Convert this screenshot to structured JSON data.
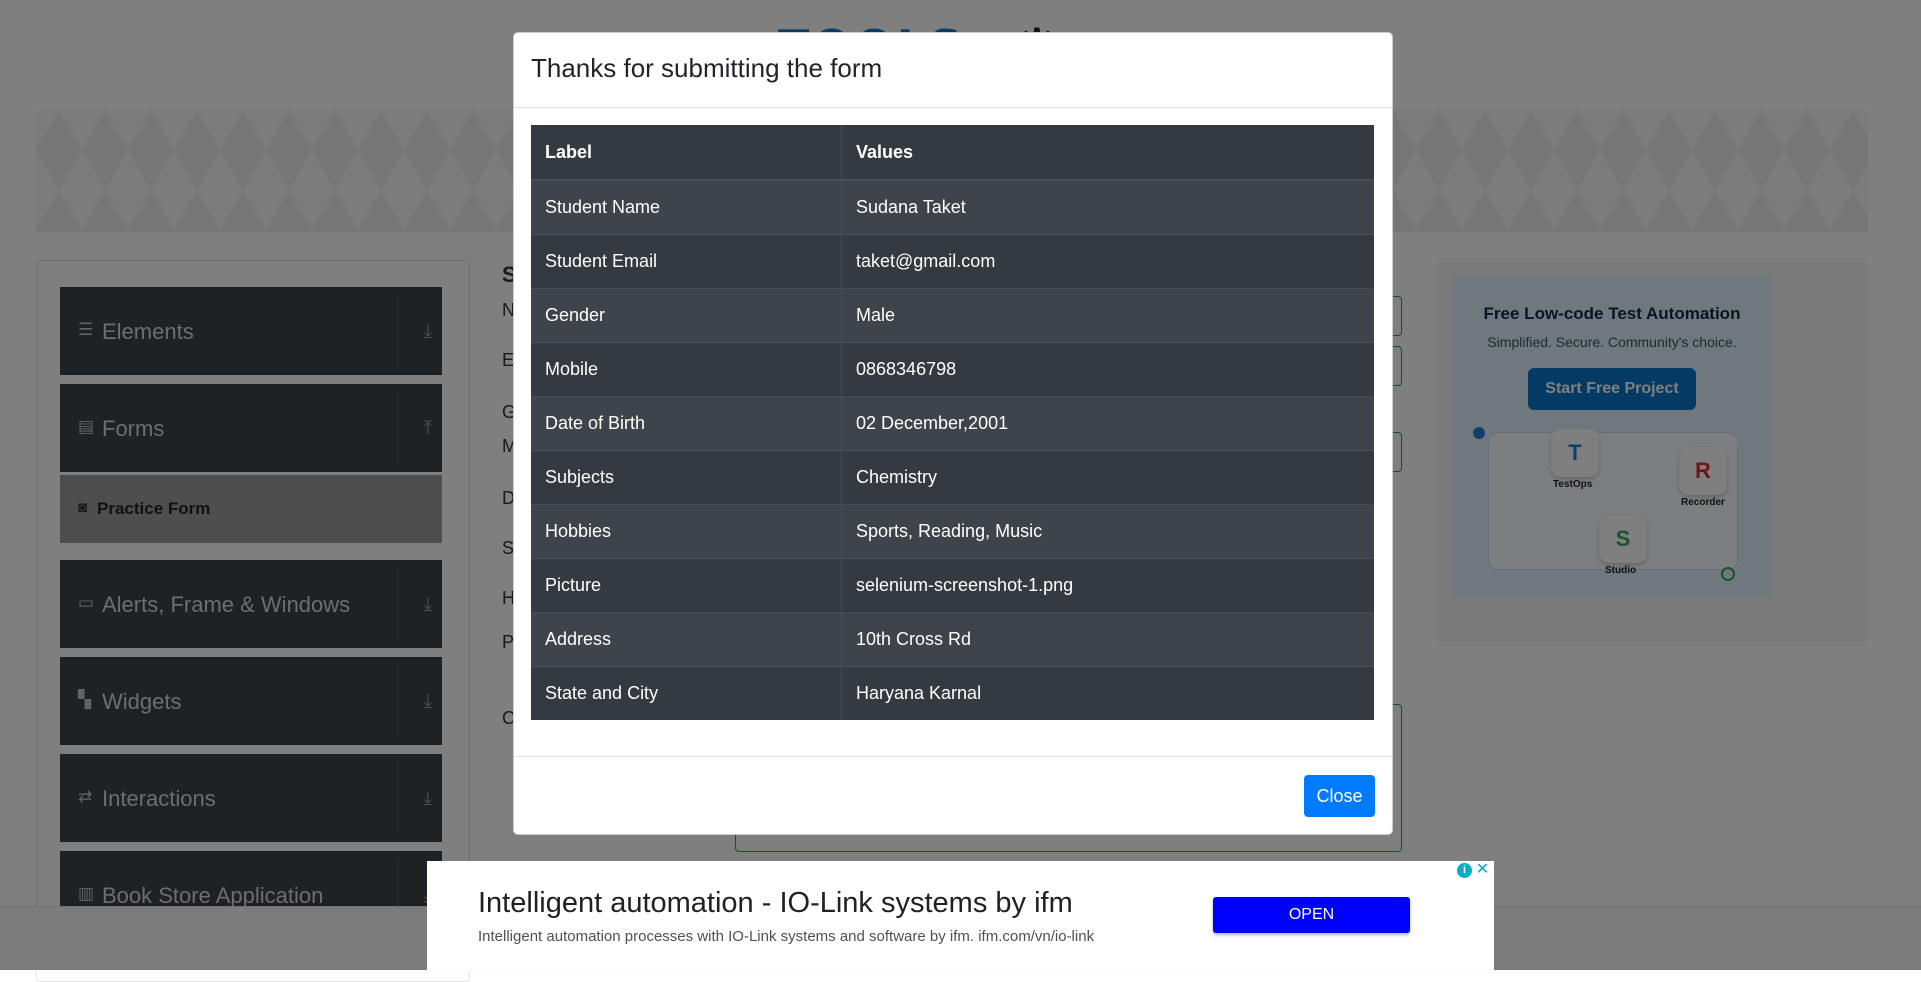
{
  "background": {
    "logo_text": "TOOLS",
    "sidebar": {
      "groups": [
        {
          "label": "Elements",
          "icon": "menu-icon",
          "arrow": "download-arrow-icon"
        },
        {
          "label": "Forms",
          "icon": "document-icon",
          "arrow": "upload-arrow-icon"
        },
        {
          "label": "Alerts, Frame & Windows",
          "icon": "window-icon",
          "arrow": "download-arrow-icon"
        },
        {
          "label": "Widgets",
          "icon": "widgets-icon",
          "arrow": "download-arrow-icon"
        },
        {
          "label": "Interactions",
          "icon": "interactions-icon",
          "arrow": "download-arrow-icon"
        },
        {
          "label": "Book Store Application",
          "icon": "books-icon",
          "arrow": "download-arrow-icon"
        }
      ],
      "active_item": {
        "label": "Practice Form",
        "icon": "html5-icon"
      }
    },
    "form_fragments": [
      "S",
      "N",
      "E",
      "G",
      "M",
      "D",
      "S",
      "H",
      "P",
      "C"
    ],
    "side_ad": {
      "title": "Free Low-code Test Automation",
      "subtitle": "Simplified. Secure. Community's choice.",
      "button": "Start Free Project",
      "tiles": [
        {
          "letter": "T",
          "label": "TestOps"
        },
        {
          "letter": "R",
          "label": "Recorder"
        },
        {
          "letter": "S",
          "label": "Studio"
        }
      ]
    }
  },
  "modal": {
    "title": "Thanks for submitting the form",
    "table": {
      "headers": [
        "Label",
        "Values"
      ],
      "rows": [
        [
          "Student Name",
          "Sudana Taket"
        ],
        [
          "Student Email",
          "taket@gmail.com"
        ],
        [
          "Gender",
          "Male"
        ],
        [
          "Mobile",
          "0868346798"
        ],
        [
          "Date of Birth",
          "02 December,2001"
        ],
        [
          "Subjects",
          "Chemistry"
        ],
        [
          "Hobbies",
          "Sports, Reading, Music"
        ],
        [
          "Picture",
          "selenium-screenshot-1.png"
        ],
        [
          "Address",
          "10th Cross Rd"
        ],
        [
          "State and City",
          "Haryana Karnal"
        ]
      ]
    },
    "close_label": "Close"
  },
  "bottom_ad": {
    "title": "Intelligent automation - IO-Link systems by ifm",
    "description": "Intelligent automation processes with IO-Link systems and software by ifm. ifm.com/vn/io-link",
    "open_label": "OPEN",
    "info_icon": "info-icon",
    "close_icon": "close-icon"
  },
  "colors": {
    "modal_table_bg": "#343a40",
    "close_button": "#007bff",
    "ad_open_button": "#0000ff",
    "sidebar_bg": "#3e4449"
  }
}
